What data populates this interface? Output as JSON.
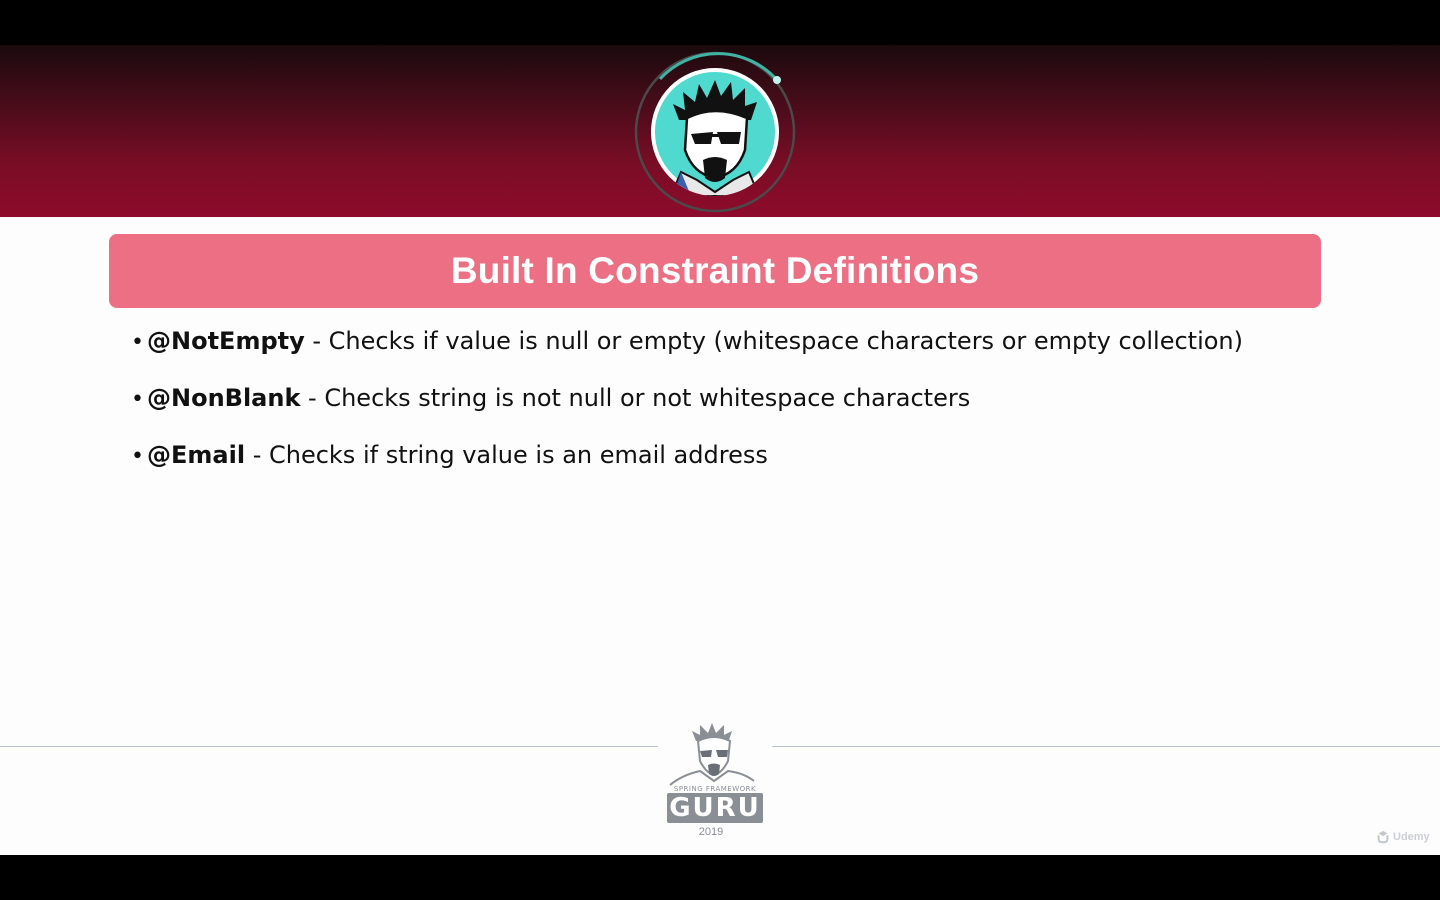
{
  "slide": {
    "title": "Built In Constraint Definitions",
    "bullets": [
      {
        "term": "@NotEmpty",
        "description": " - Checks if value is null or empty (whitespace characters or empty collection)"
      },
      {
        "term": "@NonBlank",
        "description": " - Checks string is not null or not whitespace characters"
      },
      {
        "term": "@Email",
        "description": " - Checks if string value is an email address"
      }
    ]
  },
  "footer": {
    "logo_small_text": "SPRING FRAMEWORK",
    "logo_big_text": "GURU",
    "logo_year": "2019"
  },
  "watermark": {
    "text": "Udemy"
  },
  "colors": {
    "header_gradient_top": "#1a0a0d",
    "header_gradient_bottom": "#8e0b2c",
    "title_bar": "#ec6f83",
    "avatar_ring": "#3fb3a4",
    "avatar_background": "#4fd9cf"
  }
}
